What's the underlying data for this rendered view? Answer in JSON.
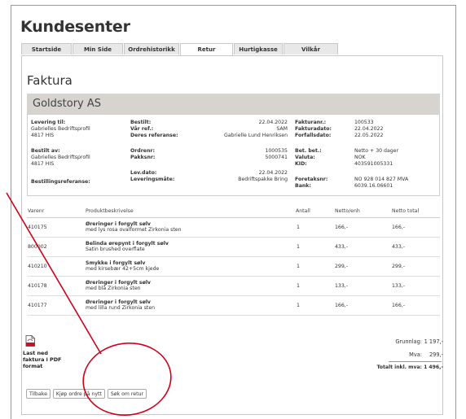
{
  "page": {
    "title": "Kundesenter"
  },
  "tabs": [
    {
      "label": "Startside",
      "width": 62
    },
    {
      "label": "Min Side",
      "width": 62
    },
    {
      "label": "Ordrehistorikk",
      "width": 68
    },
    {
      "label": "Retur",
      "width": 65,
      "active": true
    },
    {
      "label": "Hurtigkasse",
      "width": 60
    },
    {
      "label": "Vilkår",
      "width": 67
    }
  ],
  "invoice": {
    "heading": "Faktura",
    "company": "Goldstory AS",
    "levering_label": "Levering til:",
    "levering_lines": [
      "Gabrielles Bedriftsprofil",
      "4817 HIS"
    ],
    "bestilt_av_label": "Bestilt av:",
    "bestilt_av_lines": [
      "Gabrielles Bedriftsprofil",
      "4817 HIS"
    ],
    "bestillingsref_label": "Bestillingsreferanse:",
    "mid_top": [
      {
        "label": "Bestilt:",
        "value": "22.04.2022"
      },
      {
        "label": "Vår ref.:",
        "value": "SAM"
      },
      {
        "label": "Deres referanse:",
        "value": "Gabrielle Lund Henriksen"
      }
    ],
    "mid_middle": [
      {
        "label": "Ordrenr:",
        "value": "1000535"
      },
      {
        "label": "Pakksnr:",
        "value": "5000741"
      }
    ],
    "mid_bottom": [
      {
        "label": "Lev.dato:",
        "value": "22.04.2022"
      },
      {
        "label": "Leveringsmåte:",
        "value": "Bedriftspakke Bring"
      }
    ],
    "right_top": [
      {
        "label": "Fakturanr.:",
        "value": "100533"
      },
      {
        "label": "Fakturadato:",
        "value": "22.04.2022"
      },
      {
        "label": "Forfallsdato:",
        "value": "22.05.2022"
      }
    ],
    "right_middle": [
      {
        "label": "Bet. bet.:",
        "value": "Netto + 30 dager"
      },
      {
        "label": "Valuta:",
        "value": "NOK"
      },
      {
        "label": "KID:",
        "value": "403591005331"
      }
    ],
    "right_bottom": [
      {
        "label": "Foretaksnr:",
        "value": "NO 928 014 827 MVA"
      },
      {
        "label": "Bank:",
        "value": "6039.16.06601"
      }
    ]
  },
  "table": {
    "headers": {
      "varenr": "Varenr",
      "beskrivelse": "Produktbeskrivelse",
      "antall": "Antall",
      "netto_enh": "Netto/enh",
      "netto_total": "Netto total"
    },
    "rows": [
      {
        "varenr": "410175",
        "title": "Øreringer i forgylt sølv",
        "subtitle": "med lys rosa ovalformet Zirkonia sten",
        "antall": "1",
        "netto_enh": "166,-",
        "netto_total": "166,-"
      },
      {
        "varenr": "800002",
        "title": "Belinda ørepynt i forgylt sølv",
        "subtitle": "Satin brushed overflate",
        "antall": "1",
        "netto_enh": "433,-",
        "netto_total": "433,-"
      },
      {
        "varenr": "410210",
        "title": "Smykke i forgylt sølv",
        "subtitle": "med kirsebær 42+5cm kjede",
        "antall": "1",
        "netto_enh": "299,-",
        "netto_total": "299,-"
      },
      {
        "varenr": "410178",
        "title": "Øreringer i forgylt sølv",
        "subtitle": "med blå Zirkonia sten",
        "antall": "1",
        "netto_enh": "133,-",
        "netto_total": "133,-"
      },
      {
        "varenr": "410177",
        "title": "Øreringer i forgylt sølv",
        "subtitle": "med lilla rund Zirkonia sten",
        "antall": "1",
        "netto_enh": "166,-",
        "netto_total": "166,-"
      }
    ]
  },
  "pdf": {
    "icon": "pdf-file-icon",
    "label_lines": [
      "Last ned",
      "faktura i PDF",
      "format"
    ]
  },
  "totals": {
    "grunnlag_label": "Grunnlag:",
    "grunnlag_value": "1 197,-",
    "mva_label": "Mva:",
    "mva_value": "299,-",
    "total_label": "Totalt inkl. mva:",
    "total_value": "1 496,-"
  },
  "buttons": {
    "tilbake": "Tilbake",
    "kjop": "Kjøp ordre på nytt",
    "retur": "Søk om retur"
  },
  "colors": {
    "annotation": "#d0021b",
    "company_bar": "#d7d4cf"
  }
}
